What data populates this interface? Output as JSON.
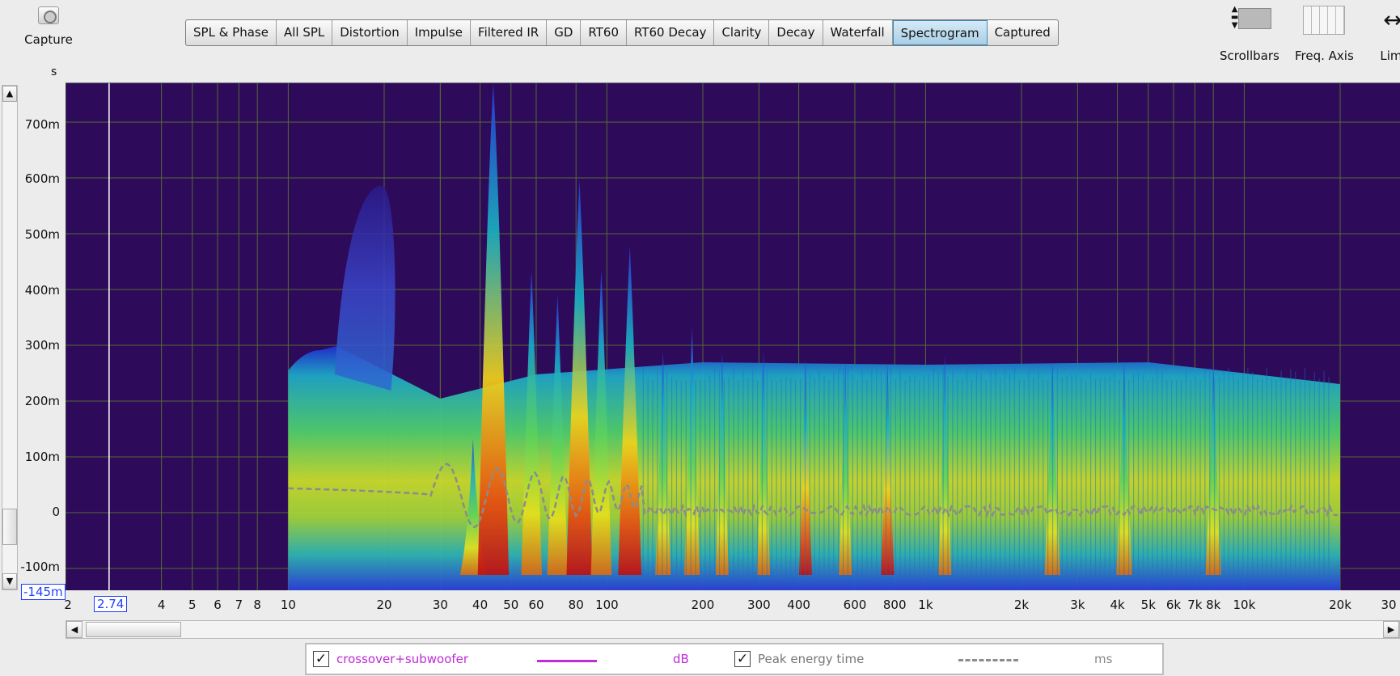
{
  "toolbar": {
    "capture_label": "Capture",
    "tabs": [
      {
        "label": "SPL & Phase",
        "active": false
      },
      {
        "label": "All SPL",
        "active": false
      },
      {
        "label": "Distortion",
        "active": false
      },
      {
        "label": "Impulse",
        "active": false
      },
      {
        "label": "Filtered IR",
        "active": false
      },
      {
        "label": "GD",
        "active": false
      },
      {
        "label": "RT60",
        "active": false
      },
      {
        "label": "RT60 Decay",
        "active": false
      },
      {
        "label": "Clarity",
        "active": false
      },
      {
        "label": "Decay",
        "active": false
      },
      {
        "label": "Waterfall",
        "active": false
      },
      {
        "label": "Spectrogram",
        "active": true
      },
      {
        "label": "Captured",
        "active": false
      }
    ],
    "scrollbars_label": "Scrollbars",
    "freq_axis_label": "Freq. Axis",
    "limits_label": "Limi"
  },
  "plot": {
    "y_unit": "s",
    "y_ticks": [
      "700m",
      "600m",
      "500m",
      "400m",
      "300m",
      "200m",
      "100m",
      "0",
      "-100m"
    ],
    "y_min_value": "-145m",
    "x_cursor_value": "2.74",
    "x_ticks": [
      "2",
      "4",
      "5",
      "6",
      "7",
      "8",
      "10",
      "20",
      "30",
      "40",
      "50",
      "60",
      "80",
      "100",
      "200",
      "300",
      "400",
      "600",
      "800",
      "1k",
      "2k",
      "3k",
      "4k",
      "5k",
      "6k",
      "7k",
      "8k",
      "10k",
      "20k",
      "30"
    ],
    "colors": {
      "background": "#2d0a5a",
      "grid": "#566b34",
      "peak_line": "#8c8c8c",
      "series": "#c02bd8",
      "cursor": "#ffffff"
    }
  },
  "legend": {
    "series_name": "crossover+subwoofer",
    "series_unit": "dB",
    "series_checked": true,
    "peak_name": "Peak energy time",
    "peak_unit": "ms",
    "peak_checked": true
  }
}
